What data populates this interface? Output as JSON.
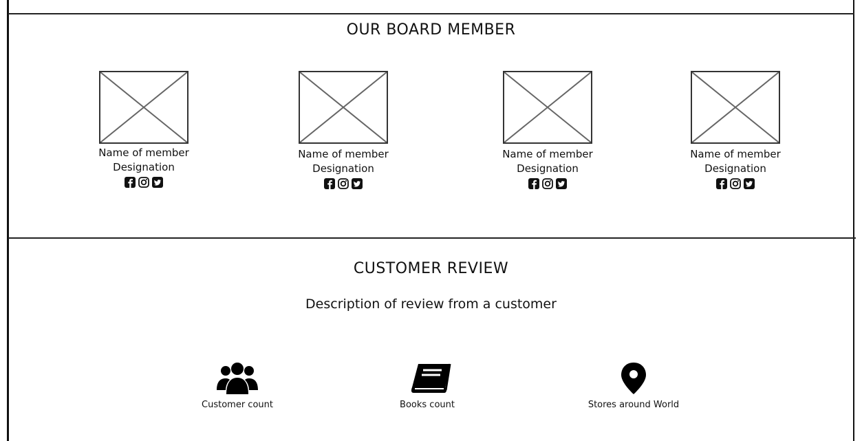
{
  "board": {
    "title": "OUR BOARD MEMBER",
    "members": [
      {
        "name": "Name of member",
        "designation": "Designation",
        "social": [
          "facebook-icon",
          "instagram-icon",
          "twitter-icon"
        ]
      },
      {
        "name": "Name of member",
        "designation": "Designation",
        "social": [
          "facebook-icon",
          "instagram-icon",
          "twitter-icon"
        ]
      },
      {
        "name": "Name of member",
        "designation": "Designation",
        "social": [
          "facebook-icon",
          "instagram-icon",
          "twitter-icon"
        ]
      },
      {
        "name": "Name of member",
        "designation": "Designation",
        "social": [
          "facebook-icon",
          "instagram-icon",
          "twitter-icon"
        ]
      }
    ]
  },
  "review": {
    "title": "CUSTOMER REVIEW",
    "description": "Description of review from a customer",
    "stats": [
      {
        "icon": "users-icon",
        "label": "Customer count"
      },
      {
        "icon": "book-icon",
        "label": "Books count"
      },
      {
        "icon": "map-marker-icon",
        "label": "Stores around World"
      }
    ]
  }
}
